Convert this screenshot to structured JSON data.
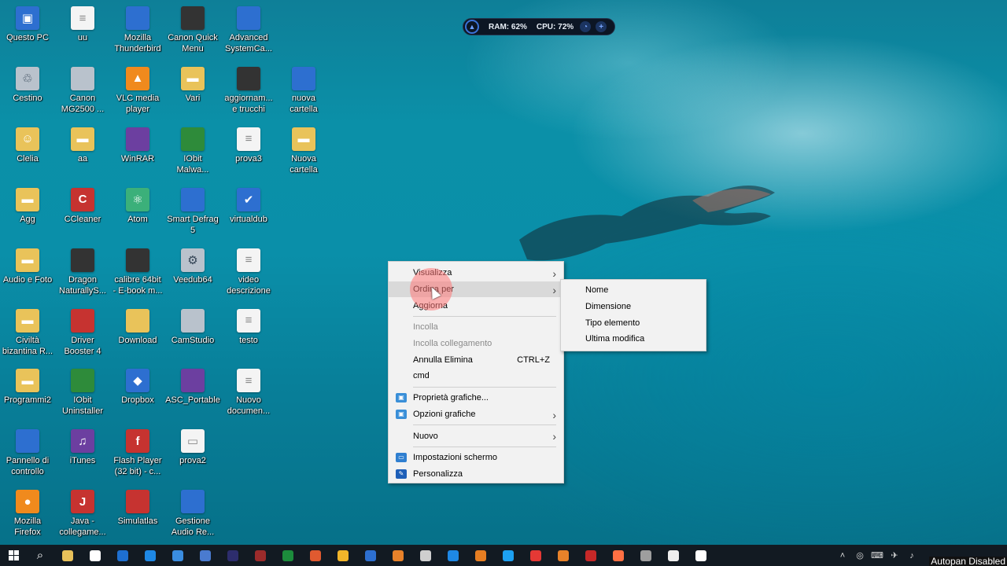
{
  "desktop": {
    "icons": [
      {
        "label": "Questo PC",
        "icon": "computer-icon"
      },
      {
        "label": "uu",
        "icon": "file-icon"
      },
      {
        "label": "Mozilla\nThunderbird",
        "icon": "thunderbird-icon"
      },
      {
        "label": "Canon Quick\nMenu",
        "icon": "canon-quick-menu-icon"
      },
      {
        "label": "Advanced\nSystemCa...",
        "icon": "advanced-systemcare-icon"
      },
      {
        "label": "Cestino",
        "icon": "recycle-bin-icon"
      },
      {
        "label": "Canon\nMG2500 ...",
        "icon": "printer-icon"
      },
      {
        "label": "VLC media\nplayer",
        "icon": "vlc-icon"
      },
      {
        "label": "Vari",
        "icon": "folder-icon"
      },
      {
        "label": "aggiornam...\ne trucchi",
        "icon": "video-file-icon"
      },
      {
        "label": "nuova\ncartella",
        "icon": "network-folder-icon"
      },
      {
        "label": "Clelia",
        "icon": "user-folder-icon"
      },
      {
        "label": "aa",
        "icon": "folder-icon"
      },
      {
        "label": "WinRAR",
        "icon": "winrar-icon"
      },
      {
        "label": "IObit\nMalwa...",
        "icon": "iobit-malware-icon"
      },
      {
        "label": "prova3",
        "icon": "file-icon"
      },
      {
        "label": "Nuova\ncartella",
        "icon": "folder-icon"
      },
      {
        "label": "Agg",
        "icon": "folder-icon"
      },
      {
        "label": "CCleaner",
        "icon": "ccleaner-icon"
      },
      {
        "label": "Atom",
        "icon": "atom-icon"
      },
      {
        "label": "Smart Defrag\n5",
        "icon": "smart-defrag-icon"
      },
      {
        "label": "virtualdub",
        "icon": "checkmark-icon"
      },
      {
        "label": "Audio e Foto",
        "icon": "folder-icon"
      },
      {
        "label": "Dragon\nNaturallyS...",
        "icon": "dragon-icon"
      },
      {
        "label": "calibre 64bit\n- E-book m...",
        "icon": "calibre-icon"
      },
      {
        "label": "Veedub64",
        "icon": "gear-icon"
      },
      {
        "label": "video\ndescrizione",
        "icon": "file-icon"
      },
      {
        "label": "Civiltà\nbizantina R...",
        "icon": "folder-icon"
      },
      {
        "label": "Driver\nBooster 4",
        "icon": "driver-booster-icon"
      },
      {
        "label": "Download",
        "icon": "download-folder-icon"
      },
      {
        "label": "CamStudio",
        "icon": "camstudio-icon"
      },
      {
        "label": "testo",
        "icon": "file-icon"
      },
      {
        "label": "Programmi2",
        "icon": "folder-icon"
      },
      {
        "label": "IObit\nUninstaller",
        "icon": "iobit-uninstaller-icon"
      },
      {
        "label": "Dropbox",
        "icon": "dropbox-icon"
      },
      {
        "label": "ASC_Portable",
        "icon": "archive-icon"
      },
      {
        "label": "Nuovo\ndocumen...",
        "icon": "file-icon"
      },
      {
        "label": "Pannello di\ncontrollo",
        "icon": "control-panel-icon"
      },
      {
        "label": "iTunes",
        "icon": "itunes-icon"
      },
      {
        "label": "Flash Player\n(32 bit) - c...",
        "icon": "flash-icon"
      },
      {
        "label": "prova2",
        "icon": "image-file-icon"
      },
      {
        "label": "Mozilla\nFirefox",
        "icon": "firefox-icon"
      },
      {
        "label": "Java -\ncollegame...",
        "icon": "java-icon"
      },
      {
        "label": "Simulatlas",
        "icon": "simulatlas-icon"
      },
      {
        "label": "Gestione\nAudio Re...",
        "icon": "audio-manager-icon"
      }
    ]
  },
  "widget": {
    "ram": "RAM: 62%",
    "cpu": "CPU: 72%"
  },
  "context_menu": {
    "items": [
      {
        "label": "Visualizza",
        "submenu": true
      },
      {
        "label": "Ordina per",
        "submenu": true,
        "highlighted": true
      },
      {
        "label": "Aggiorna"
      },
      {
        "label": "Incolla",
        "disabled": true
      },
      {
        "label": "Incolla collegamento",
        "disabled": true
      },
      {
        "label": "Annulla Elimina",
        "shortcut": "CTRL+Z"
      },
      {
        "label": "cmd"
      },
      {
        "label": "Proprietà grafiche...",
        "icon": "graphics-icon"
      },
      {
        "label": "Opzioni grafiche",
        "icon": "graphics-icon",
        "submenu": true
      },
      {
        "label": "Nuovo",
        "submenu": true
      },
      {
        "label": "Impostazioni schermo",
        "icon": "display-icon"
      },
      {
        "label": "Personalizza",
        "icon": "personalize-icon"
      }
    ]
  },
  "submenu": {
    "items": [
      "Nome",
      "Dimensione",
      "Tipo elemento",
      "Ultima modifica"
    ]
  },
  "taskbar": {
    "tray_text": "Autopan Disabled",
    "apps": [
      "file-explorer",
      "store",
      "outlook",
      "edge",
      "ie",
      "dragon",
      "media",
      "winamp",
      "monitor",
      "m-app",
      "red-app",
      "green-app",
      "ccleaner",
      "chrome",
      "dropbox",
      "vlc",
      "audio",
      "iobit",
      "firefox",
      "circle-app",
      "firefox2",
      "photos",
      "notepad",
      "snip"
    ]
  },
  "colors": {
    "menu_bg": "#f2f2f2",
    "menu_hover": "#d9d9d9",
    "taskbar_bg": "#121a22",
    "click_indicator": "#ff7878"
  }
}
